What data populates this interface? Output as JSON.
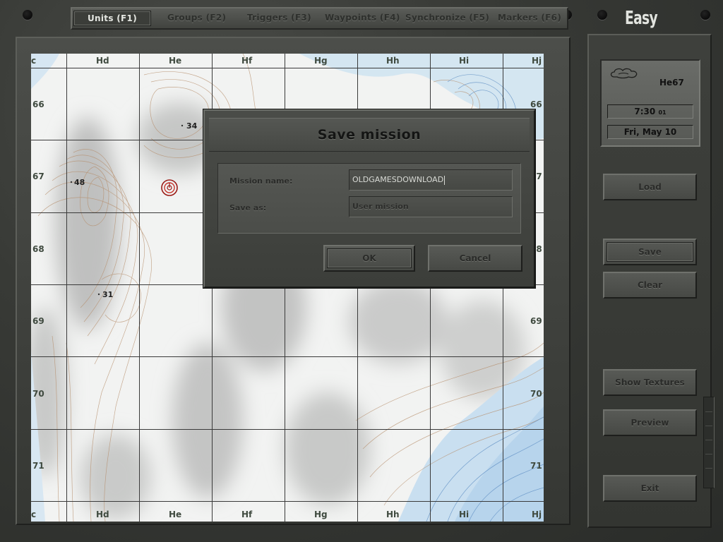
{
  "difficulty": "Easy",
  "tabs": [
    {
      "label": "Units (F1)",
      "active": true
    },
    {
      "label": "Groups (F2)",
      "active": false
    },
    {
      "label": "Triggers (F3)",
      "active": false
    },
    {
      "label": "Waypoints (F4)",
      "active": false
    },
    {
      "label": "Synchronize (F5)",
      "active": false
    },
    {
      "label": "Markers (F6)",
      "active": false
    }
  ],
  "map": {
    "columns": [
      "c",
      "Hd",
      "He",
      "Hf",
      "Hg",
      "Hh",
      "Hi",
      "Hj"
    ],
    "rows": [
      "66",
      "67",
      "68",
      "69",
      "70",
      "71"
    ],
    "elevations": [
      {
        "label": "34"
      },
      {
        "label": "48"
      },
      {
        "label": "31"
      }
    ]
  },
  "dialog": {
    "title": "Save mission",
    "mission_name_label": "Mission name:",
    "mission_name_value": "OLDGAMESDOWNLOAD",
    "save_as_label": "Save as:",
    "save_as_value": "User mission",
    "ok_label": "OK",
    "cancel_label": "Cancel"
  },
  "info": {
    "weather_icon": "cloud-icon",
    "grid": "He67",
    "time": "7:30",
    "seconds": "01",
    "date": "Fri, May 10"
  },
  "side_buttons": {
    "load": "Load",
    "save": "Save",
    "clear": "Clear",
    "show_textures": "Show Textures",
    "preview": "Preview",
    "exit": "Exit"
  }
}
